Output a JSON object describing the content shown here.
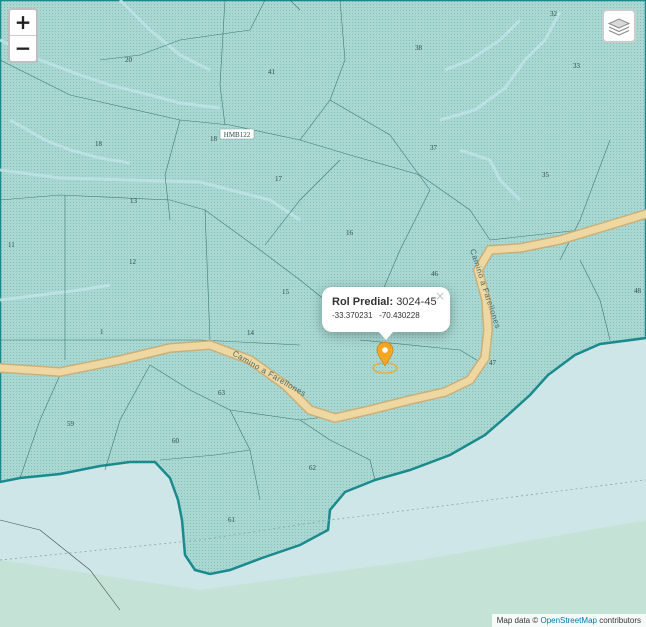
{
  "zoom": {
    "in_label": "+",
    "out_label": "−"
  },
  "popup": {
    "title_prefix": "Rol Predial:",
    "rol": "3024-45",
    "lat": "-33.370231",
    "lon": "-70.430228",
    "close_symbol": "×"
  },
  "attribution": {
    "prefix": "Map data ©",
    "link": "OpenStreetMap",
    "suffix": "contributors"
  },
  "map": {
    "road_name": "Camino a Farellones",
    "road_code": "HMB122",
    "parcels": [
      "32",
      "38",
      "33",
      "20",
      "41",
      "18",
      "18",
      "37",
      "35",
      "17",
      "13",
      "16",
      "11",
      "12",
      "46",
      "15",
      "48",
      "1",
      "14",
      "47",
      "63",
      "59",
      "60",
      "62",
      "61"
    ],
    "colors": {
      "parcel_fill": "#a9d8d3",
      "water": "#cfe6e8",
      "boundary": "#1b8a8c",
      "road": "#efd7a2",
      "marker": "#f5a623"
    }
  }
}
